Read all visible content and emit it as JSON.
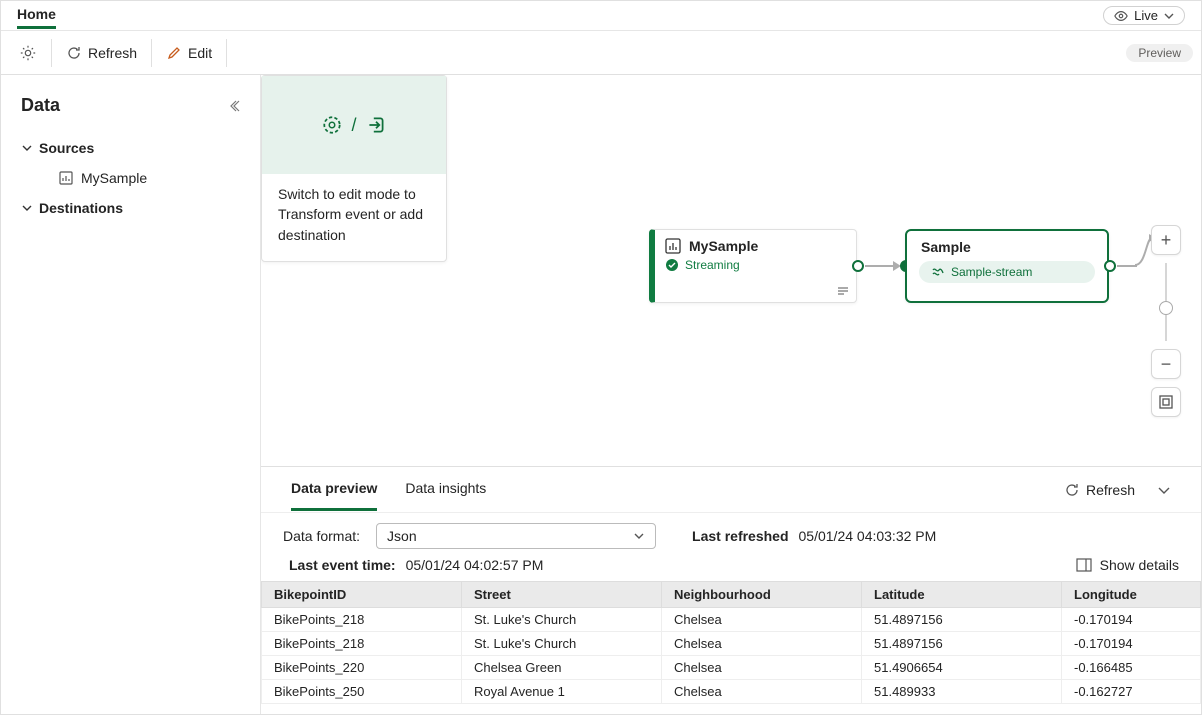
{
  "header": {
    "main_tab": "Home",
    "live_label": "Live"
  },
  "toolbar": {
    "refresh": "Refresh",
    "edit": "Edit",
    "preview": "Preview"
  },
  "sidebar": {
    "title": "Data",
    "sources_label": "Sources",
    "destinations_label": "Destinations",
    "source_item": "MySample"
  },
  "canvas": {
    "source": {
      "title": "MySample",
      "status": "Streaming"
    },
    "stream": {
      "title": "Sample",
      "chip": "Sample-stream"
    },
    "destination_hint": "Switch to edit mode to Transform event or add destination",
    "slash": "/"
  },
  "preview": {
    "tab_preview": "Data preview",
    "tab_insights": "Data insights",
    "refresh": "Refresh",
    "data_format_label": "Data format:",
    "data_format_value": "Json",
    "last_refreshed_label": "Last refreshed",
    "last_refreshed_value": "05/01/24 04:03:32 PM",
    "last_event_label": "Last event time:",
    "last_event_value": "05/01/24 04:02:57 PM",
    "show_details": "Show details",
    "columns": {
      "c0": "BikepointID",
      "c1": "Street",
      "c2": "Neighbourhood",
      "c3": "Latitude",
      "c4": "Longitude"
    },
    "rows": [
      {
        "c0": "BikePoints_218",
        "c1": "St. Luke's Church",
        "c2": "Chelsea",
        "c3": "51.4897156",
        "c4": "-0.170194"
      },
      {
        "c0": "BikePoints_218",
        "c1": "St. Luke's Church",
        "c2": "Chelsea",
        "c3": "51.4897156",
        "c4": "-0.170194"
      },
      {
        "c0": "BikePoints_220",
        "c1": "Chelsea Green",
        "c2": "Chelsea",
        "c3": "51.4906654",
        "c4": "-0.166485"
      },
      {
        "c0": "BikePoints_250",
        "c1": "Royal Avenue 1",
        "c2": "Chelsea",
        "c3": "51.489933",
        "c4": "-0.162727"
      }
    ]
  }
}
